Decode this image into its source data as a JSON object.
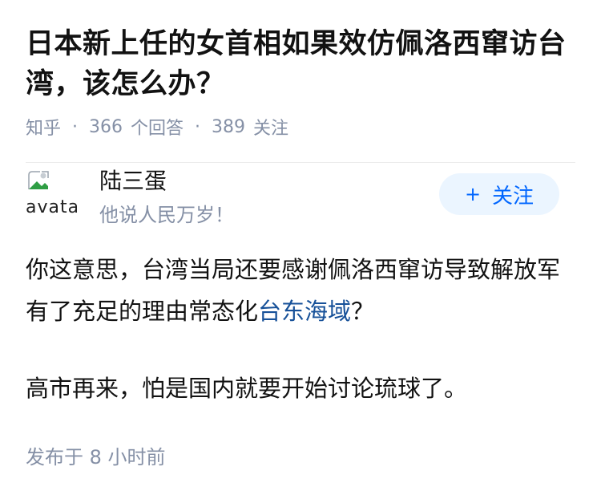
{
  "question": {
    "title": "日本新上任的女首相如果效仿佩洛西窜访台湾，该怎么办？",
    "source": "知乎",
    "answer_count": "366",
    "answer_label": "个回答",
    "follower_count": "389",
    "follower_label": "关注",
    "separator": "·"
  },
  "author": {
    "avatar_alt": "avatar",
    "name": "陆三蛋",
    "bio": "他说人民万岁！",
    "follow_label": "关注",
    "follow_icon": "plus-icon"
  },
  "answer": {
    "para1_before": "你这意思，台湾当局还要感谢佩洛西窜访导致解放军有了充足的理由常态化",
    "para1_link": "台东海域",
    "para1_after": "？",
    "para2": "高市再来，怕是国内就要开始讨论琉球了。",
    "published": "发布于 8 小时前"
  },
  "colors": {
    "link": "#175199",
    "accent": "#0066ff",
    "follow_bg": "#ebf5ff",
    "muted": "#8590a6"
  }
}
